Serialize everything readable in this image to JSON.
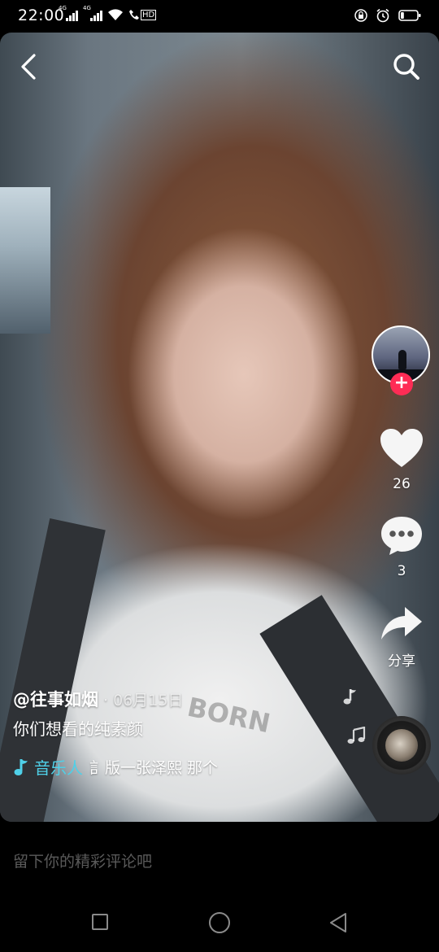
{
  "status_bar": {
    "time": "22:00",
    "network_1": "4G",
    "network_2": "4G",
    "hd_label": "HD",
    "battery_level": 0.2
  },
  "video": {
    "shirt_print": "BORN"
  },
  "header": {
    "back_icon": "chevron-left-icon",
    "search_icon": "search-icon"
  },
  "right_rail": {
    "follow_label": "+",
    "like_count": "26",
    "comment_count": "3",
    "share_label": "分享"
  },
  "caption": {
    "author": "@往事如烟",
    "date": "· 06月15日",
    "description": "你们想看的纯素颜",
    "music_tag": "音乐人",
    "music_text": "訁版一张泽熙   那个"
  },
  "comment_bar": {
    "placeholder": "留下你的精彩评论吧"
  },
  "colors": {
    "accent": "#fe2c55",
    "music_tag": "#4fd0e8"
  }
}
